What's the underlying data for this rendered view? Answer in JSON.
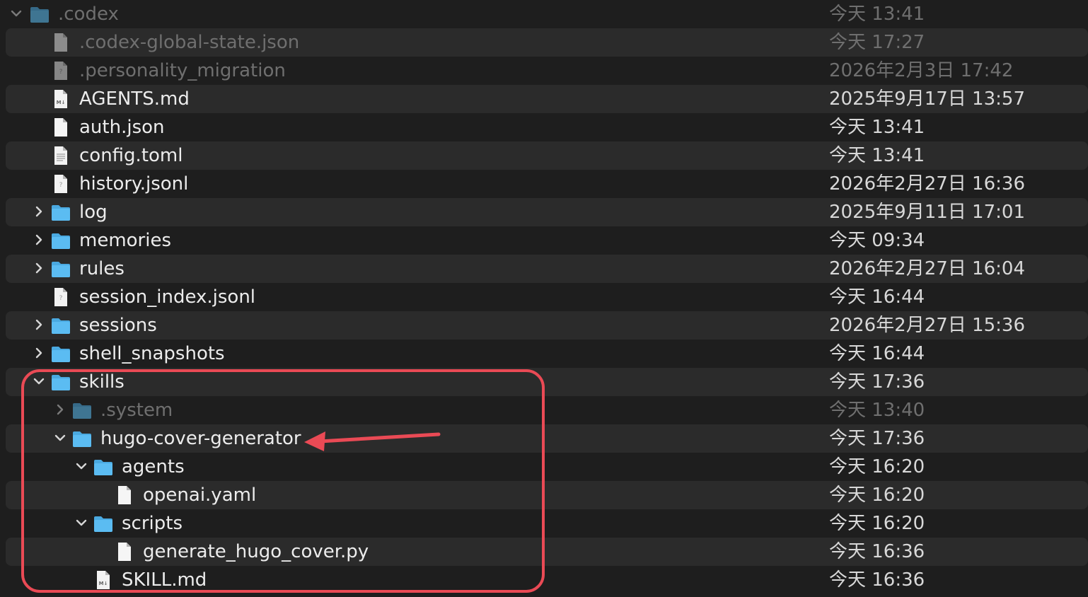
{
  "colors": {
    "folder": "#5bbcf2",
    "folder_tab": "#4aa9e0",
    "annotation": "#ea4a55",
    "row_stripe": "#2b2b2b",
    "background": "#1e1e1e"
  },
  "rows": [
    {
      "name": ".codex",
      "date": "今天 13:41",
      "kind": "folder",
      "expanded": true
    },
    {
      "name": ".codex-global-state.json",
      "date": "今天 17:27",
      "kind": "file"
    },
    {
      "name": ".personality_migration",
      "date": "2026年2月3日 17:42",
      "kind": "file"
    },
    {
      "name": "AGENTS.md",
      "date": "2025年9月17日 13:57",
      "kind": "markdown-file"
    },
    {
      "name": "auth.json",
      "date": "今天 13:41",
      "kind": "file"
    },
    {
      "name": "config.toml",
      "date": "今天 13:41",
      "kind": "text-file"
    },
    {
      "name": "history.jsonl",
      "date": "2026年2月27日 16:36",
      "kind": "file"
    },
    {
      "name": "log",
      "date": "2025年9月11日 17:01",
      "kind": "folder",
      "expanded": false
    },
    {
      "name": "memories",
      "date": "今天 09:34",
      "kind": "folder",
      "expanded": false
    },
    {
      "name": "rules",
      "date": "2026年2月27日 16:04",
      "kind": "folder",
      "expanded": false
    },
    {
      "name": "session_index.jsonl",
      "date": "今天 16:44",
      "kind": "file"
    },
    {
      "name": "sessions",
      "date": "2026年2月27日 15:36",
      "kind": "folder",
      "expanded": false
    },
    {
      "name": "shell_snapshots",
      "date": "今天 16:44",
      "kind": "folder",
      "expanded": false
    },
    {
      "name": "skills",
      "date": "今天 17:36",
      "kind": "folder",
      "expanded": true
    },
    {
      "name": ".system",
      "date": "今天 13:40",
      "kind": "folder",
      "expanded": false
    },
    {
      "name": "hugo-cover-generator",
      "date": "今天 17:36",
      "kind": "folder",
      "expanded": true
    },
    {
      "name": "agents",
      "date": "今天 16:20",
      "kind": "folder",
      "expanded": true
    },
    {
      "name": "openai.yaml",
      "date": "今天 16:20",
      "kind": "file"
    },
    {
      "name": "scripts",
      "date": "今天 16:20",
      "kind": "folder",
      "expanded": true
    },
    {
      "name": "generate_hugo_cover.py",
      "date": "今天 16:36",
      "kind": "file"
    },
    {
      "name": "SKILL.md",
      "date": "今天 16:36",
      "kind": "markdown-file"
    }
  ]
}
